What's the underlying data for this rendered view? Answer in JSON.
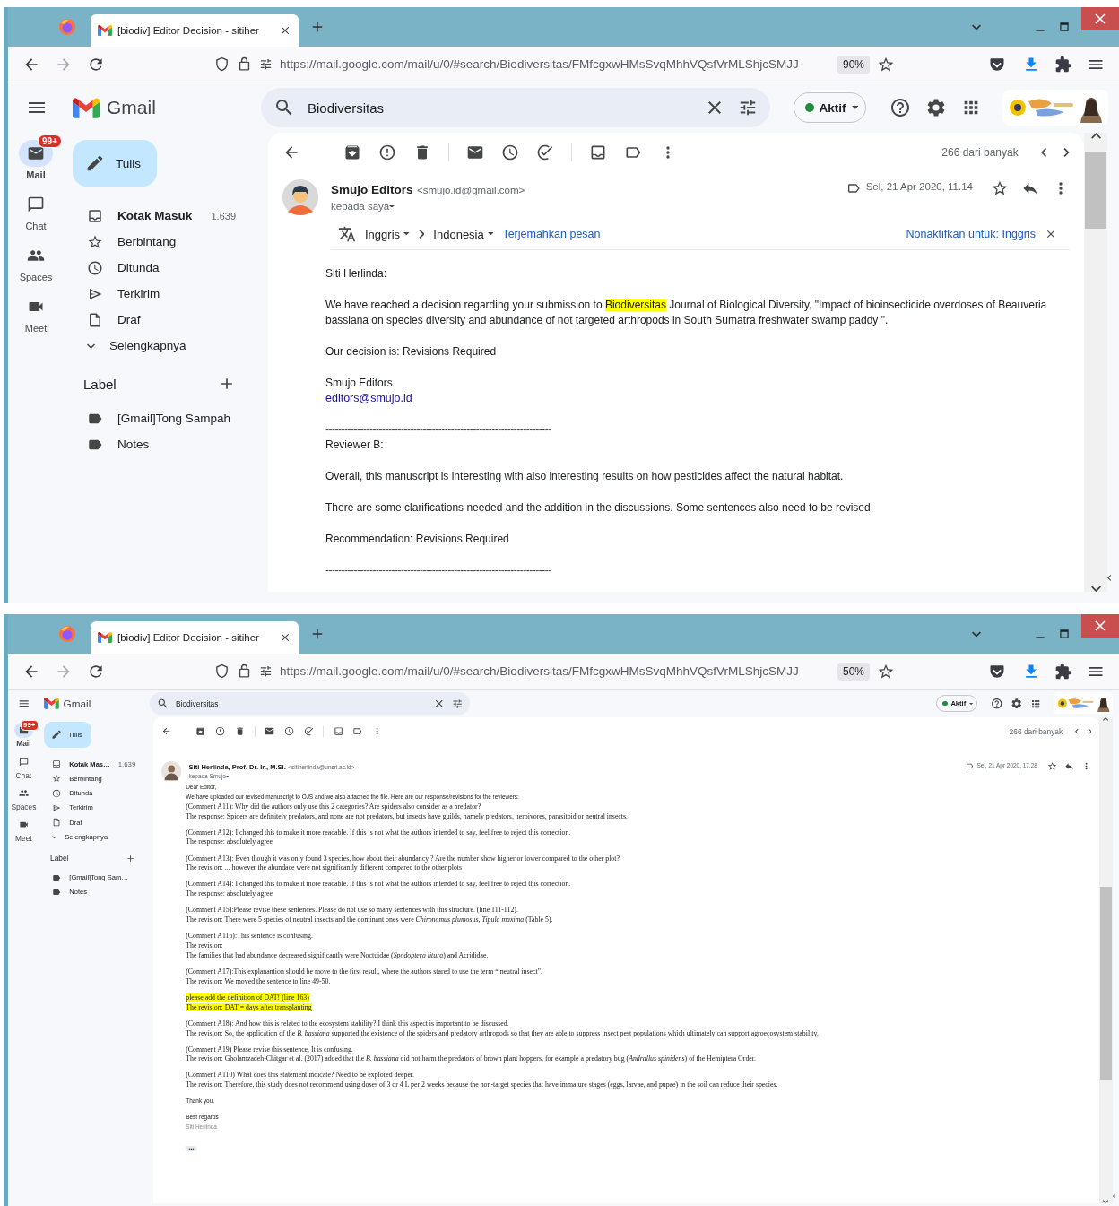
{
  "windows": [
    {
      "tab_title": "[biodiv] Editor Decision - sitiher",
      "url": "https://mail.google.com/mail/u/0/#search/Biodiversitas/FMfcgxwHMsSvqMhhVQsfVrMLShjcSMJJ",
      "zoom": "90%",
      "app_name": "Gmail",
      "search": "Biodiversitas",
      "status": "Aktif",
      "compose": "Tulis",
      "rail": [
        {
          "label": "Mail",
          "selected": true,
          "badge": "99+"
        },
        {
          "label": "Chat",
          "selected": false
        },
        {
          "label": "Spaces",
          "selected": false
        },
        {
          "label": "Meet",
          "selected": false
        }
      ],
      "folders": [
        {
          "label": "Kotak Masuk",
          "count": "1.639",
          "unread": true
        },
        {
          "label": "Berbintang",
          "unread": false
        },
        {
          "label": "Ditunda",
          "unread": false
        },
        {
          "label": "Terkirim",
          "unread": false
        },
        {
          "label": "Draf",
          "unread": false
        },
        {
          "label": "Selengkapnya",
          "unread": false
        }
      ],
      "labels_heading": "Label",
      "labels": [
        "[Gmail]Tong Sampah",
        "Notes"
      ],
      "counter": "266 dari banyak",
      "email": {
        "avatar": {
          "kind": "illustration"
        },
        "sender": "Smujo Editors",
        "address": "<smujo.id@gmail.com>",
        "recipient": "kepada saya",
        "date": "Sel, 21 Apr 2020, 11.14",
        "translate": {
          "from": "Inggris",
          "to": "Indonesia",
          "action": "Terjemahkan pesan",
          "disable": "Nonaktifkan untuk: Inggris"
        },
        "paragraphs": [
          {
            "highlight": false,
            "lines": [
              {
                "kind": "sans",
                "text": "Siti Herlinda:"
              }
            ]
          },
          {
            "highlight": false,
            "lines": [
              {
                "kind": "sans",
                "segments": [
                  {
                    "text": "We have reached a decision regarding your submission to ",
                    "highlight": false
                  },
                  {
                    "text": "Biodiversitas",
                    "highlight": true
                  },
                  {
                    "text": " Journal of Biological Diversity, \"Impact of bioinsecticide overdoses of Beauveria bassiana on species diversity and abundance of not targeted arthropods in South Sumatra freshwater swamp paddy \".",
                    "highlight": false
                  }
                ]
              }
            ]
          },
          {
            "highlight": false,
            "lines": [
              {
                "kind": "sans",
                "text": "Our decision is: Revisions Required"
              }
            ]
          },
          {
            "highlight": false,
            "lines": [
              {
                "kind": "sans",
                "text": "Smujo Editors"
              },
              {
                "kind": "link",
                "text": "editors@smujo.id"
              }
            ]
          },
          {
            "highlight": false,
            "lines": [
              {
                "kind": "rule",
                "text": "------------------------------------------------------------------------"
              },
              {
                "kind": "sans",
                "text": "Reviewer B:"
              }
            ]
          },
          {
            "highlight": false,
            "lines": [
              {
                "kind": "sans",
                "text": "Overall, this manuscript is interesting with also interesting results on how pesticides affect the natural habitat."
              }
            ]
          },
          {
            "highlight": false,
            "lines": [
              {
                "kind": "sans",
                "text": "There are some clarifications needed and the addition in the discussions. Some sentences also need to be revised."
              }
            ]
          },
          {
            "highlight": false,
            "lines": [
              {
                "kind": "sans",
                "text": "Recommendation: Revisions Required"
              }
            ]
          },
          {
            "highlight": false,
            "lines": [
              {
                "kind": "rule",
                "text": "------------------------------------------------------------------------"
              }
            ]
          }
        ]
      }
    },
    {
      "tab_title": "[biodiv] Editor Decision - sitiher",
      "url": "https://mail.google.com/mail/u/0/#search/Biodiversitas/FMfcgxwHMsSvqMhhVQsfVrMLShjcSMJJ",
      "zoom": "50%",
      "app_name": "Gmail",
      "search": "Biodiversitas",
      "status": "Aktif",
      "compose": "Tulis",
      "rail": [
        {
          "label": "Mail",
          "selected": true,
          "badge": "99+"
        },
        {
          "label": "Chat",
          "selected": false
        },
        {
          "label": "Spaces",
          "selected": false
        },
        {
          "label": "Meet",
          "selected": false
        }
      ],
      "folders": [
        {
          "label": "Kotak Mas…",
          "count": "1.639",
          "unread": true
        },
        {
          "label": "Berbintang",
          "unread": false
        },
        {
          "label": "Ditunda",
          "unread": false
        },
        {
          "label": "Terkirim",
          "unread": false
        },
        {
          "label": "Draf",
          "unread": false
        },
        {
          "label": "Selengkapnya",
          "unread": false
        }
      ],
      "labels_heading": "Label",
      "labels": [
        "[Gmail]Tong Sam…",
        "Notes"
      ],
      "counter": "266 dari banyak",
      "email": {
        "sender": "Siti Herlinda, Prof. Dr. Ir., M.Si.",
        "address": "<sitiherlinda@unsri.ac.id>",
        "recipient": "kepada Smujo",
        "date": "Sel, 21 Apr 2020, 17.28",
        "trimmed": "•••",
        "paragraphs": [
          {
            "highlight": false,
            "lines": [
              {
                "kind": "sans",
                "text": "Dear Editor,"
              },
              {
                "kind": "sans",
                "text": "We have uploaded our revised manuscript to OJS and we also attached the file. Here are our response/revisions for the reviewers:"
              },
              {
                "kind": "serif",
                "text": "(Comment A11): Why did the authors only use this 2 categories? Are spiders also consider as a predator?"
              },
              {
                "kind": "serif",
                "text": "The response: Spiders are definitely predators, and none are not predators, but insects have guilds, namely predators, herbivores, parasitoid or neutral insects."
              }
            ]
          },
          {
            "highlight": false,
            "lines": [
              {
                "kind": "serif",
                "text": "(Comment A12): I changed this to make it more readable. If this is not what the authors intended to say, feel free to reject this correction."
              },
              {
                "kind": "serif",
                "text": "The response: absolutely agree"
              }
            ]
          },
          {
            "highlight": false,
            "lines": [
              {
                "kind": "serif",
                "text": "(Comment A13): Even though it was only found 3 species, how about their abundancy ? Are the number show higher or lower compared to the other plot?"
              },
              {
                "kind": "serif",
                "text": "The revision: ... however the abundace were not significantly different compared to the other plots"
              }
            ]
          },
          {
            "highlight": false,
            "lines": [
              {
                "kind": "serif",
                "text": "(Comment A14): I changed this to make it more readable. If this is not what the authors intended to say, feel free to reject this correction."
              },
              {
                "kind": "serif",
                "text": "The response: absolutely agree"
              }
            ]
          },
          {
            "highlight": false,
            "lines": [
              {
                "kind": "serif",
                "text": "(Comment A15):Please revise these sentences. Please do not use so many sentences with this structure. (line 111-112)."
              },
              {
                "kind": "serif",
                "text": "The revision: There were 5 species of neutral insects and the dominant ones were *Chironomus plumosus*, *Tipula maxima* (Table 5)."
              }
            ]
          },
          {
            "highlight": false,
            "lines": [
              {
                "kind": "serif",
                "text": "(Comment A116):This sentence is confusing."
              },
              {
                "kind": "serif",
                "text": "The revision:"
              },
              {
                "kind": "serif",
                "text": "The families that had abundance decreased significantly were Noctuidae (*Spodoptera litura*) and Acrididae."
              }
            ]
          },
          {
            "highlight": false,
            "lines": [
              {
                "kind": "serif",
                "text": "(Comment A17):This explanantion should be move to the first result, where the authors stared to use the term “ neutral insect”."
              },
              {
                "kind": "serif",
                "text": "The revision: We moved the sentence to line 49-50."
              }
            ]
          },
          {
            "highlight": true,
            "lines": [
              {
                "kind": "serif",
                "text": "please add the definition of DAT! (line 163)"
              },
              {
                "kind": "serif",
                "text": "The revision: DAT = days after transplanting"
              }
            ]
          },
          {
            "highlight": false,
            "lines": [
              {
                "kind": "serif",
                "text": "(Comment A18): And how this is related to the ecosystem stability? I think this aspect is important to be discussed."
              },
              {
                "kind": "serif",
                "text": "The revision: So, the application of the *B. bassiana* supported the existence of the spiders and predatory arthropods so that they are able to suppress insect pest populations which ultimately can support agroecosystem stability."
              }
            ]
          },
          {
            "highlight": false,
            "lines": [
              {
                "kind": "serif",
                "text": "(Comment A19) Please revise this sentence, It is confusing."
              },
              {
                "kind": "serif",
                "text": "The revision: Gholamzadeh-Chitgar et al. (2017) added that the *B. bassiana* did not harm the predators of brown plant hoppers, for example a predatory bug (*Andrallus spinidens*) of the Hemiptera Order."
              }
            ]
          },
          {
            "highlight": false,
            "lines": [
              {
                "kind": "serif",
                "text": "(Comment A110) What does this statement indicate? Need to be explored deeper."
              },
              {
                "kind": "serif",
                "text": "The revision: Therefore, this study does not recommend using doses of 3 or 4 L per 2 weeks because the non-target species that have immature stages (eggs, larvae, and pupae) in the soil can reduce their species."
              }
            ]
          },
          {
            "highlight": false,
            "lines": [
              {
                "kind": "sans",
                "text": "Thank you."
              }
            ]
          },
          {
            "highlight": false,
            "lines": [
              {
                "kind": "sans",
                "text": "Best regards"
              },
              {
                "kind": "muted",
                "text": "Siti Herlinda"
              }
            ]
          }
        ]
      }
    }
  ]
}
